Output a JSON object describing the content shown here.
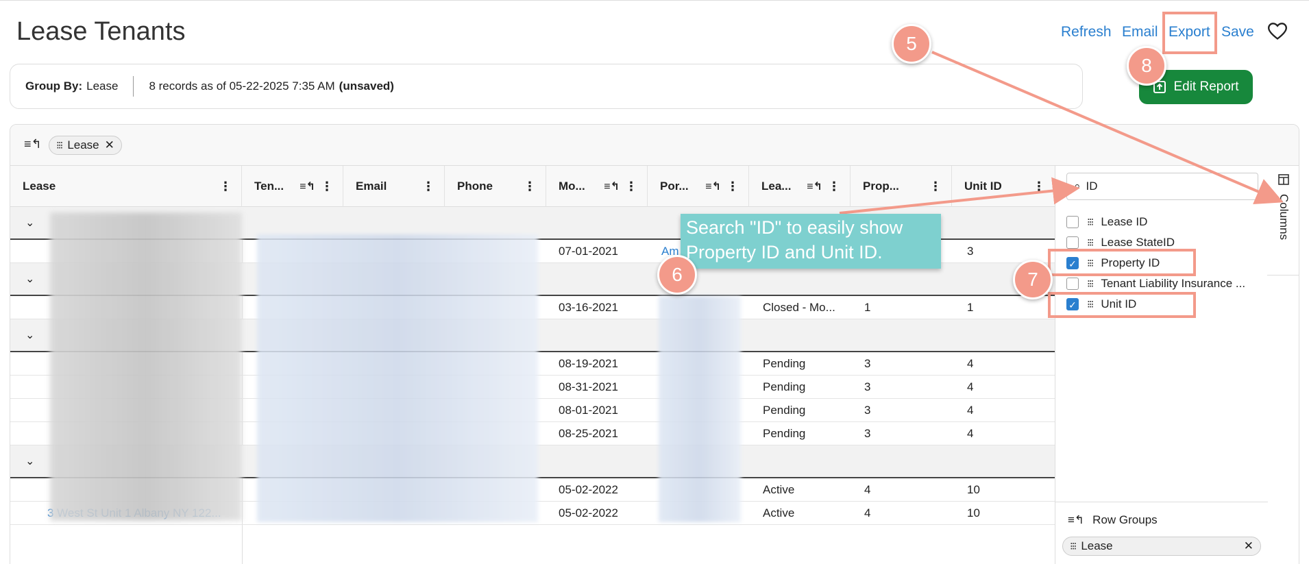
{
  "page": {
    "title": "Lease Tenants"
  },
  "toolbar": {
    "refresh": "Refresh",
    "email": "Email",
    "export": "Export",
    "save": "Save",
    "edit_report": "Edit Report"
  },
  "summary": {
    "group_by_label": "Group By:",
    "group_by_value": "Lease",
    "records": "8 records as of 05-22-2025 7:35 AM",
    "unsaved": "(unsaved)"
  },
  "group_chip": {
    "label": "Lease"
  },
  "columns": [
    {
      "label": "Lease",
      "sort": false
    },
    {
      "label": "Ten...",
      "sort": true
    },
    {
      "label": "Email",
      "sort": false
    },
    {
      "label": "Phone",
      "sort": false
    },
    {
      "label": "Mo...",
      "sort": true
    },
    {
      "label": "Por...",
      "sort": true
    },
    {
      "label": "Lea...",
      "sort": true
    },
    {
      "label": "Prop...",
      "sort": false
    },
    {
      "label": "Unit ID",
      "sort": false
    }
  ],
  "rows": [
    {
      "date": "07-01-2021",
      "portal": "Am",
      "status": "",
      "prop": "",
      "unit": "3"
    },
    {
      "date": "03-16-2021",
      "portal": "",
      "status": "Closed - Mo...",
      "prop": "1",
      "unit": "1"
    },
    {
      "date": "08-19-2021",
      "portal": "",
      "status": "Pending",
      "prop": "3",
      "unit": "4"
    },
    {
      "date": "08-31-2021",
      "portal": "",
      "status": "Pending",
      "prop": "3",
      "unit": "4"
    },
    {
      "date": "08-01-2021",
      "portal": "",
      "status": "Pending",
      "prop": "3",
      "unit": "4"
    },
    {
      "date": "08-25-2021",
      "portal": "",
      "status": "Pending",
      "prop": "3",
      "unit": "4"
    },
    {
      "date": "05-02-2022",
      "portal": "",
      "status": "Active",
      "prop": "4",
      "unit": "10"
    },
    {
      "date": "05-02-2022",
      "portal": "",
      "status": "Active",
      "prop": "4",
      "unit": "10"
    }
  ],
  "last_lease_text": "3 West St Unit 1 Albany NY 122...",
  "side_panel": {
    "search_value": "ID",
    "items": [
      {
        "label": "Lease ID",
        "checked": false
      },
      {
        "label": "Lease StateID",
        "checked": false
      },
      {
        "label": "Property ID",
        "checked": true
      },
      {
        "label": "Tenant Liability Insurance ...",
        "checked": false
      },
      {
        "label": "Unit ID",
        "checked": true
      }
    ],
    "tab_label": "Columns",
    "row_groups_label": "Row Groups",
    "row_group_chip": "Lease"
  },
  "annotations": {
    "callout": "Search \"ID\" to easily show Property ID and Unit ID.",
    "badge5": "5",
    "badge6": "6",
    "badge7": "7",
    "badge8": "8"
  },
  "colors": {
    "accent": "#2a7fcf",
    "edit_button": "#17883c",
    "callout": "#7ed0cf",
    "badge": "#f39a8a"
  }
}
